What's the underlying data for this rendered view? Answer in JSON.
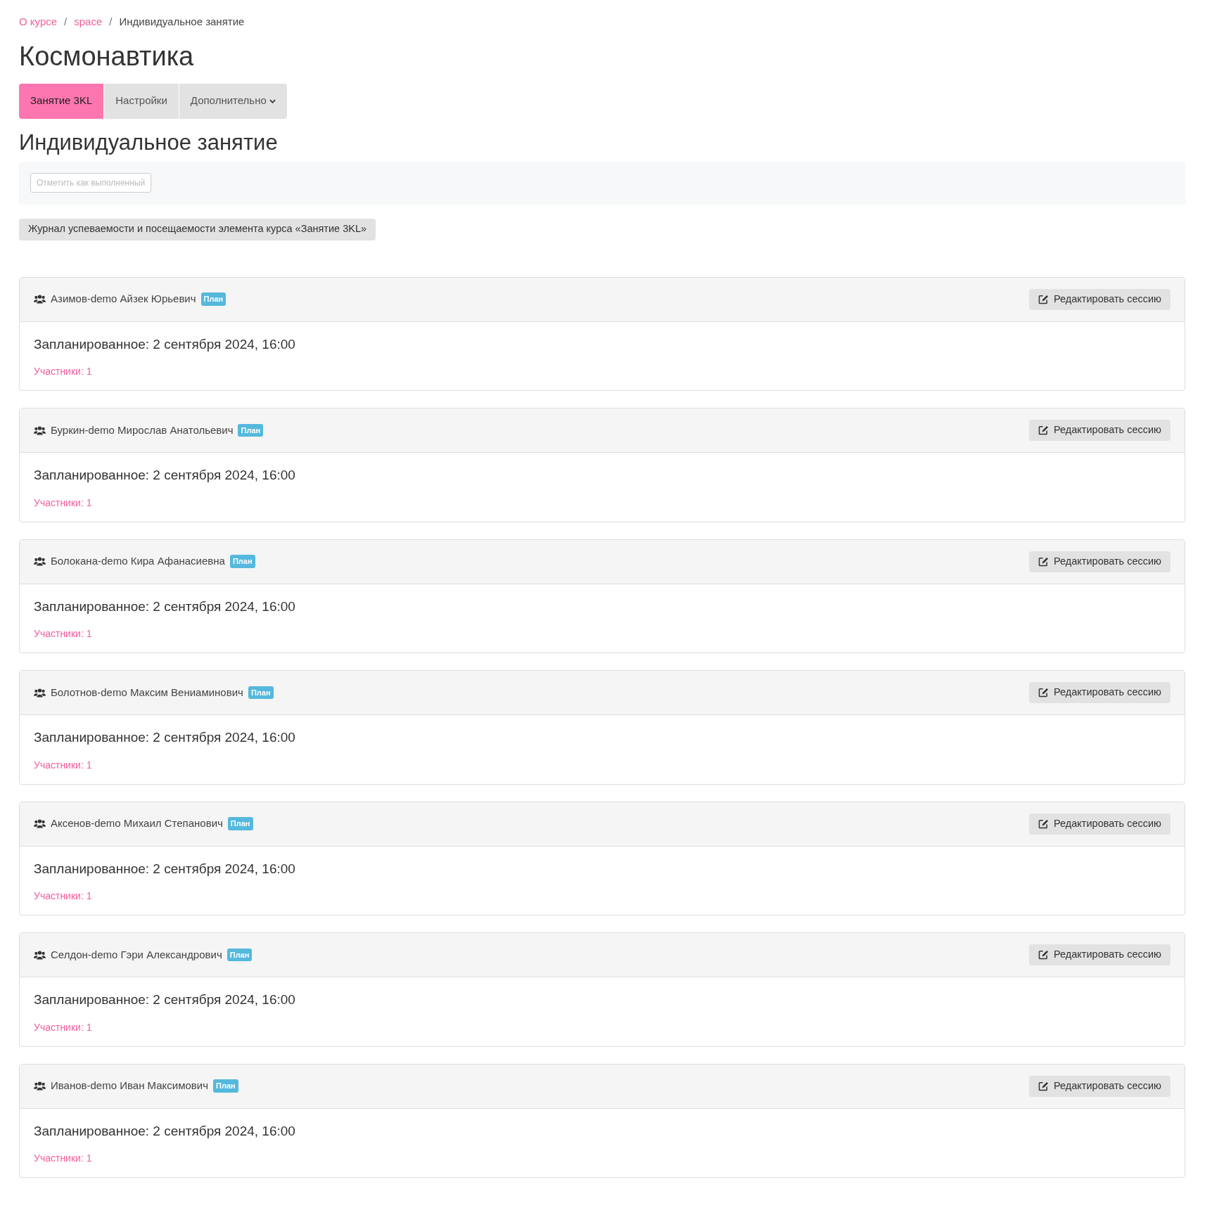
{
  "breadcrumb": [
    {
      "label": "О курсе",
      "link": true
    },
    {
      "label": "space",
      "link": true
    },
    {
      "label": "Индивидуальное занятие",
      "link": false
    }
  ],
  "separator": "/",
  "course_title": "Космонавтика",
  "tabs": [
    {
      "label": "Занятие 3KL",
      "selected": true,
      "dropdown": false
    },
    {
      "label": "Настройки",
      "selected": false,
      "dropdown": false
    },
    {
      "label": "Дополнительно",
      "selected": false,
      "dropdown": true
    }
  ],
  "page_title": "Индивидуальное занятие",
  "complete_button": {
    "label": "Отметить как выполненный",
    "disabled": true
  },
  "journal_button": "Журнал успеваемости и посещаемости элемента курса «Занятие 3KL»",
  "sessions": [
    {
      "name": "Азимов-demo Айзек Юрьевич",
      "badge": "План",
      "edit": "Редактировать сессию",
      "scheduled": "Запланированное: 2 сентября 2024, 16:00",
      "participants": "Участники: 1"
    },
    {
      "name": "Буркин-demo Мирослав Анатольевич",
      "badge": "План",
      "edit": "Редактировать сессию",
      "scheduled": "Запланированное: 2 сентября 2024, 16:00",
      "participants": "Участники: 1"
    },
    {
      "name": "Болокана-demo Кира Афанасиевна",
      "badge": "План",
      "edit": "Редактировать сессию",
      "scheduled": "Запланированное: 2 сентября 2024, 16:00",
      "participants": "Участники: 1"
    },
    {
      "name": "Болотнов-demo Максим Вениаминович",
      "badge": "План",
      "edit": "Редактировать сессию",
      "scheduled": "Запланированное: 2 сентября 2024, 16:00",
      "participants": "Участники: 1"
    },
    {
      "name": "Аксенов-demo Михаил Степанович",
      "badge": "План",
      "edit": "Редактировать сессию",
      "scheduled": "Запланированное: 2 сентября 2024, 16:00",
      "participants": "Участники: 1"
    },
    {
      "name": "Селдон-demo Гэри Александрович",
      "badge": "План",
      "edit": "Редактировать сессию",
      "scheduled": "Запланированное: 2 сентября 2024, 16:00",
      "participants": "Участники: 1"
    },
    {
      "name": "Иванов-demo Иван Максимович",
      "badge": "План",
      "edit": "Редактировать сессию",
      "scheduled": "Запланированное: 2 сентября 2024, 16:00",
      "participants": "Участники: 1"
    }
  ]
}
